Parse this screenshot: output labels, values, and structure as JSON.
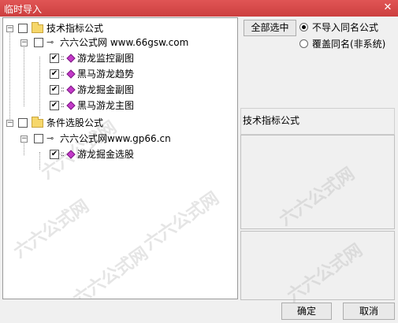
{
  "window": {
    "title": "临时导入",
    "close_label": "✕"
  },
  "tree": {
    "groups": [
      {
        "label": "技术指标公式",
        "children": [
          {
            "label": "六六公式网 www.66gsw.com",
            "items": [
              "游龙监控副图",
              "黑马游龙趋势",
              "游龙掘金副图",
              "黑马游龙主图"
            ]
          }
        ]
      },
      {
        "label": "条件选股公式",
        "children": [
          {
            "label": "六六公式网www.gp66.cn",
            "items": [
              "游龙掘金选股"
            ]
          }
        ]
      }
    ]
  },
  "options": {
    "select_all_label": "全部选中",
    "radio_no_import_label": "不导入同名公式",
    "radio_overwrite_label": "覆盖同名(非系统)",
    "selected": "不导入同名公式"
  },
  "info": {
    "category_label": "技术指标公式"
  },
  "footer": {
    "ok_label": "确定",
    "cancel_label": "取消"
  },
  "icons": {
    "expand_glyph": "−",
    "check_glyph": "✔",
    "key_glyph": "⊸",
    "dots_glyph": "::"
  },
  "watermark_text": "六六公式网"
}
